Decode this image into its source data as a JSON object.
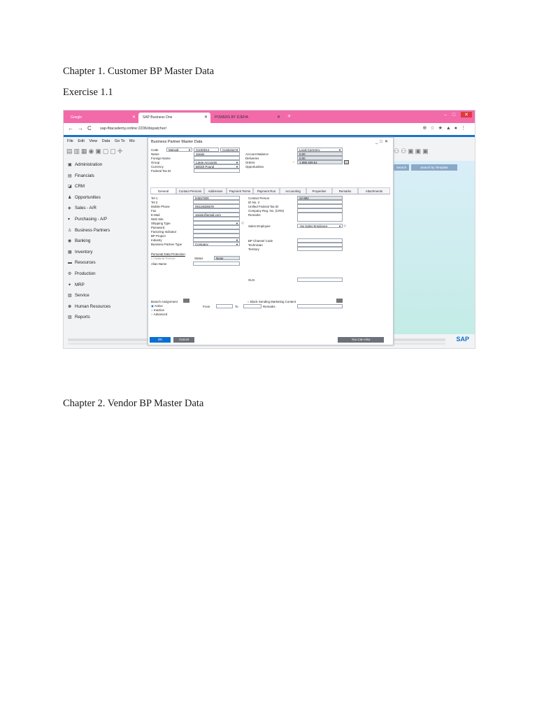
{
  "document": {
    "chapter1": "Chapter 1. Customer BP Master Data",
    "exercise": "Exercise 1.1",
    "chapter2": "Chapter 2. Vendor BP Master Data"
  },
  "browser": {
    "tabs": [
      {
        "label": "Google"
      },
      {
        "label": "SAP Business One"
      },
      {
        "label": "POWERS BY DJEHA"
      }
    ],
    "url": "sap-fitacademy.online:2206/dispatcher/"
  },
  "sap": {
    "menu": [
      "File",
      "Edit",
      "View",
      "Data",
      "Go To",
      "Mo"
    ],
    "modules": [
      {
        "label": "Administration",
        "icon": "admin-icon"
      },
      {
        "label": "Financials",
        "icon": "financials-icon"
      },
      {
        "label": "CRM",
        "icon": "crm-icon"
      },
      {
        "label": "Opportunities",
        "icon": "opportunities-icon"
      },
      {
        "label": "Sales - A/R",
        "icon": "sales-icon"
      },
      {
        "label": "Purchasing - A/P",
        "icon": "purchasing-icon"
      },
      {
        "label": "Business Partners",
        "icon": "business-partners-icon"
      },
      {
        "label": "Banking",
        "icon": "banking-icon"
      },
      {
        "label": "Inventory",
        "icon": "inventory-icon"
      },
      {
        "label": "Resources",
        "icon": "resources-icon"
      },
      {
        "label": "Production",
        "icon": "production-icon"
      },
      {
        "label": "MRP",
        "icon": "mrp-icon"
      },
      {
        "label": "Service",
        "icon": "service-icon"
      },
      {
        "label": "Human Resources",
        "icon": "hr-icon"
      },
      {
        "label": "Reports",
        "icon": "reports-icon"
      }
    ],
    "search_label": "Search",
    "search_template_label": "Search by Template",
    "logo": "SAP"
  },
  "dialog": {
    "title": "Business Partner Master Data",
    "header": {
      "code_label": "Code",
      "code_series": "Manual",
      "code_value": "CUS0014",
      "code_type": "Customer",
      "name_label": "Name",
      "name_value": "Jassie",
      "foreign_name_label": "Foreign Name",
      "group_label": "Group",
      "group_value": "Large Accounts",
      "currency_label": "Currency",
      "currency_value": "British Pound",
      "federal_tax_label": "Federal Tax ID",
      "currency_mode": "Local Currency",
      "account_balance_label": "Account Balance",
      "account_balance": "0.00",
      "deliveries_label": "Deliveries",
      "deliveries": "0.00",
      "orders_label": "Orders",
      "orders": "1,988,409.51",
      "opportunities_label": "Opportunities"
    },
    "tabs": [
      "General",
      "Contact Persons",
      "Addresses",
      "Payment Terms",
      "Payment Run",
      "Accounting",
      "Properties",
      "Remarks",
      "Attachments"
    ],
    "general": {
      "tel1_label": "Tel 1",
      "tel1": "94657809",
      "tel2_label": "Tel 2",
      "mobile_label": "Mobile Phone",
      "mobile": "09124826578",
      "fax_label": "Fax",
      "email_label": "E-Mail",
      "email": "Jassie@gmail.com",
      "web_label": "Web Site",
      "shipping_label": "Shipping Type",
      "password_label": "Password",
      "factoring_label": "Factoring Indicator",
      "bp_project_label": "BP Project",
      "industry_label": "Industry",
      "bp_type_label": "Business Partner Type",
      "bp_type_value": "Company",
      "contact_person_label": "Contact Person",
      "contact_person": "22-882",
      "id2_label": "ID No. 2",
      "unified_tax_label": "Unified Federal Tax ID",
      "company_reg_label": "Company Reg. No. (CRN)",
      "remarks_label": "Remarks",
      "sales_employee_label": "Sales Employee",
      "sales_employee": "-No Sales Employee-",
      "bp_channel_label": "BP Channel Code",
      "technician_label": "Technician",
      "territory_label": "Territory",
      "pdp_label": "Personal Data Protection",
      "natural_person_label": "Natural Person",
      "status_label": "Status",
      "status_value": "None",
      "alias_label": "Alias Name",
      "glib_label": "GLN",
      "branch_label": "Branch Assignment",
      "block_label": "Block Sending Marketing Content",
      "active_label": "Active",
      "inactive_label": "Inactive",
      "advanced_label": "Advanced",
      "from_label": "From",
      "to_label": "To",
      "remarks2_label": "Remarks"
    },
    "buttons": {
      "ok": "OK",
      "cancel": "Cancel",
      "you_can_also": "You Can Also"
    }
  }
}
